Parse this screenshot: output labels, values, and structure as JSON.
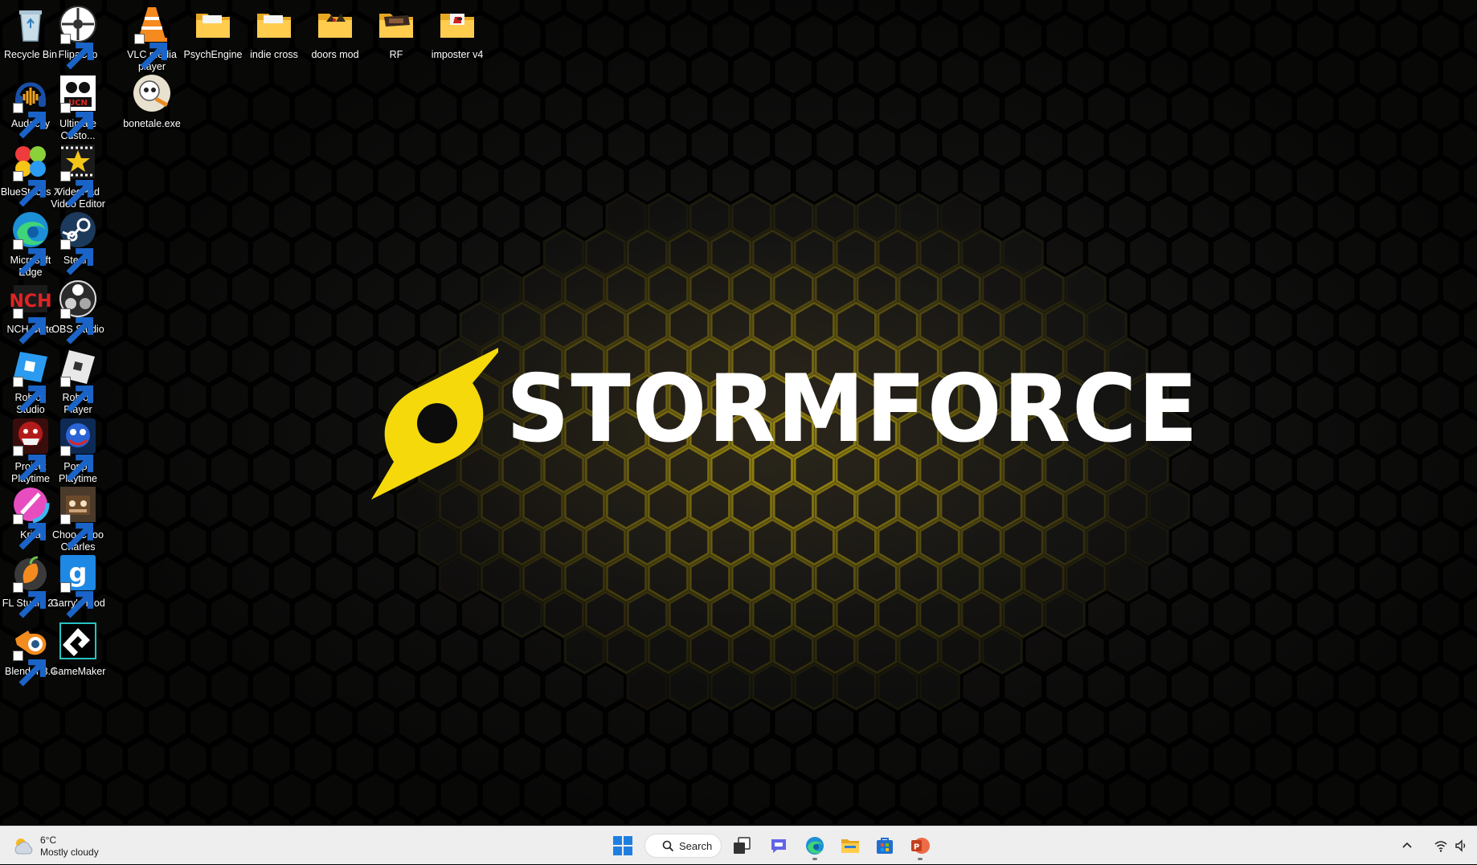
{
  "desktop": {
    "wallpaper": {
      "brand_text": "STORMFORCE",
      "trademark": "™",
      "accent_color": "#f5d90a"
    },
    "icons": [
      {
        "name": "Recycle Bin",
        "icon": "recycle-bin-icon",
        "shortcut": false
      },
      {
        "name": "FlipaClip",
        "icon": "flipaclip-icon",
        "shortcut": true
      },
      {
        "name": "VLC media player",
        "icon": "vlc-icon",
        "shortcut": true
      },
      {
        "name": "PsychEngine",
        "icon": "folder-icon",
        "shortcut": false
      },
      {
        "name": "indie cross",
        "icon": "folder-icon",
        "shortcut": false
      },
      {
        "name": "doors mod",
        "icon": "folder-icon",
        "shortcut": false
      },
      {
        "name": "RF",
        "icon": "folder-icon",
        "shortcut": false
      },
      {
        "name": "imposter v4",
        "icon": "folder-icon",
        "shortcut": false
      },
      {
        "name": "Audacity",
        "icon": "audacity-icon",
        "shortcut": true
      },
      {
        "name": "Ultimate Custo...",
        "icon": "ucn-icon",
        "shortcut": true
      },
      {
        "name": "bonetale.exe",
        "icon": "bonetale-icon",
        "shortcut": false
      },
      {
        "name": "BlueStacks X",
        "icon": "bluestacks-icon",
        "shortcut": true
      },
      {
        "name": "VideoPad Video Editor",
        "icon": "videopad-icon",
        "shortcut": true
      },
      {
        "name": "Microsoft Edge",
        "icon": "edge-icon",
        "shortcut": true
      },
      {
        "name": "Steam",
        "icon": "steam-icon",
        "shortcut": true
      },
      {
        "name": "NCH Suite",
        "icon": "nch-icon",
        "shortcut": true
      },
      {
        "name": "OBS Studio",
        "icon": "obs-icon",
        "shortcut": true
      },
      {
        "name": "Roblox Studio",
        "icon": "roblox-studio-icon",
        "shortcut": true
      },
      {
        "name": "Roblox Player",
        "icon": "roblox-player-icon",
        "shortcut": true
      },
      {
        "name": "Project Playtime",
        "icon": "project-playtime-icon",
        "shortcut": true
      },
      {
        "name": "Poppy Playtime",
        "icon": "poppy-playtime-icon",
        "shortcut": true
      },
      {
        "name": "Krita",
        "icon": "krita-icon",
        "shortcut": true
      },
      {
        "name": "Choo-Choo Charles",
        "icon": "choo-choo-charles-icon",
        "shortcut": true
      },
      {
        "name": "FL Studio 21",
        "icon": "fl-studio-icon",
        "shortcut": true
      },
      {
        "name": "Garry's Mod",
        "icon": "garrys-mod-icon",
        "shortcut": true
      },
      {
        "name": "Blender 3.4",
        "icon": "blender-icon",
        "shortcut": true
      },
      {
        "name": "GameMaker",
        "icon": "gamemaker-icon",
        "shortcut": true
      }
    ]
  },
  "taskbar": {
    "weather": {
      "temperature": "6°C",
      "condition": "Mostly cloudy",
      "icon": "cloudy-sun-icon"
    },
    "search_label": "Search",
    "apps": [
      {
        "name": "start",
        "icon": "windows-start-icon",
        "running": false
      },
      {
        "name": "task-view",
        "icon": "task-view-icon",
        "running": false
      },
      {
        "name": "chat",
        "icon": "teams-chat-icon",
        "running": false
      },
      {
        "name": "edge",
        "icon": "edge-icon",
        "running": true
      },
      {
        "name": "file-explorer",
        "icon": "folder-icon",
        "running": false
      },
      {
        "name": "store",
        "icon": "microsoft-store-icon",
        "running": false
      },
      {
        "name": "powerpoint",
        "icon": "powerpoint-icon",
        "running": true
      }
    ],
    "tray": [
      "chevron-up-icon",
      "wifi-icon",
      "speaker-icon"
    ]
  }
}
